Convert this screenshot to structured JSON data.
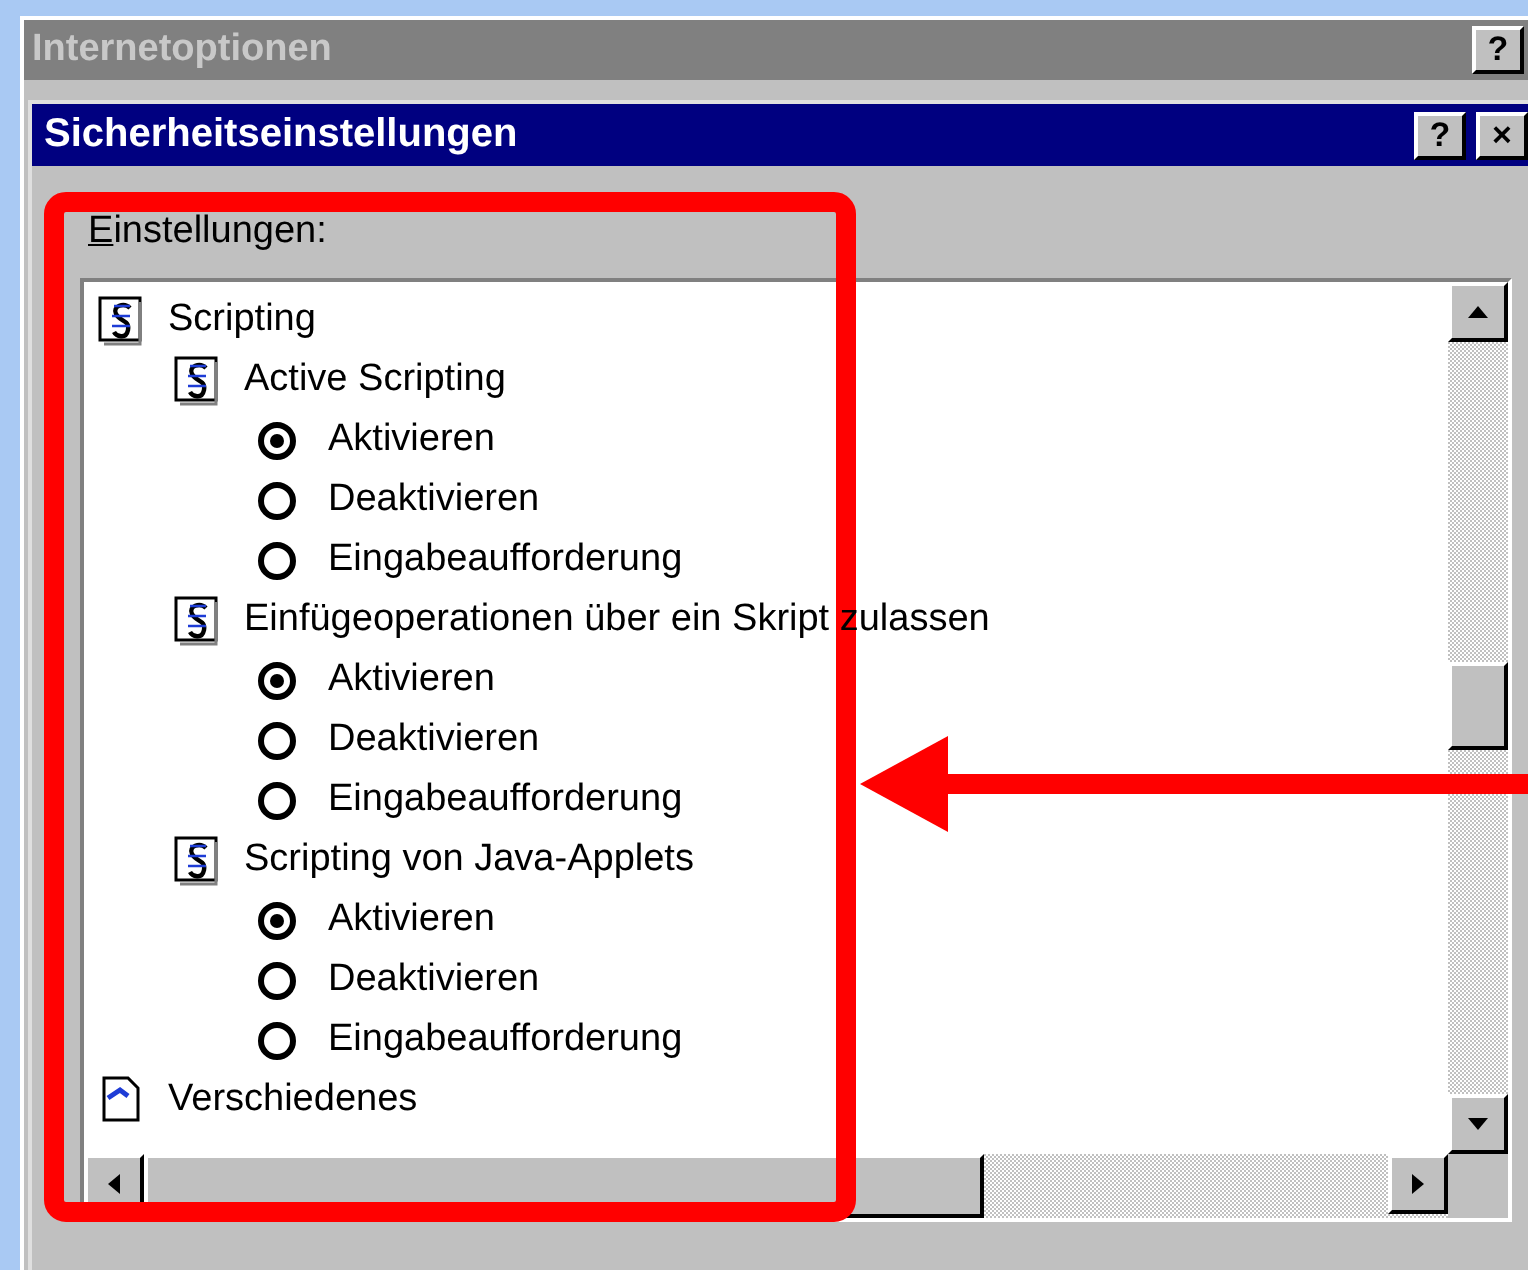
{
  "back_window": {
    "title": "Internetoptionen",
    "help_button": "?"
  },
  "dialog": {
    "title": "Sicherheitseinstellungen",
    "help_button": "?",
    "close_button": "×",
    "settings_label": "Einstellungen:",
    "tree": [
      {
        "label": "Scripting",
        "kind": "script",
        "children": [
          {
            "label": "Active Scripting",
            "kind": "script",
            "options": [
              {
                "label": "Aktivieren",
                "selected": true
              },
              {
                "label": "Deaktivieren",
                "selected": false
              },
              {
                "label": "Eingabeaufforderung",
                "selected": false
              }
            ]
          },
          {
            "label": "Einfügeoperationen über ein Skript zulassen",
            "kind": "script",
            "options": [
              {
                "label": "Aktivieren",
                "selected": true
              },
              {
                "label": "Deaktivieren",
                "selected": false
              },
              {
                "label": "Eingabeaufforderung",
                "selected": false
              }
            ]
          },
          {
            "label": "Scripting von Java-Applets",
            "kind": "script",
            "options": [
              {
                "label": "Aktivieren",
                "selected": true
              },
              {
                "label": "Deaktivieren",
                "selected": false
              },
              {
                "label": "Eingabeaufforderung",
                "selected": false
              }
            ]
          }
        ]
      },
      {
        "label": "Verschiedenes",
        "kind": "misc"
      }
    ]
  }
}
